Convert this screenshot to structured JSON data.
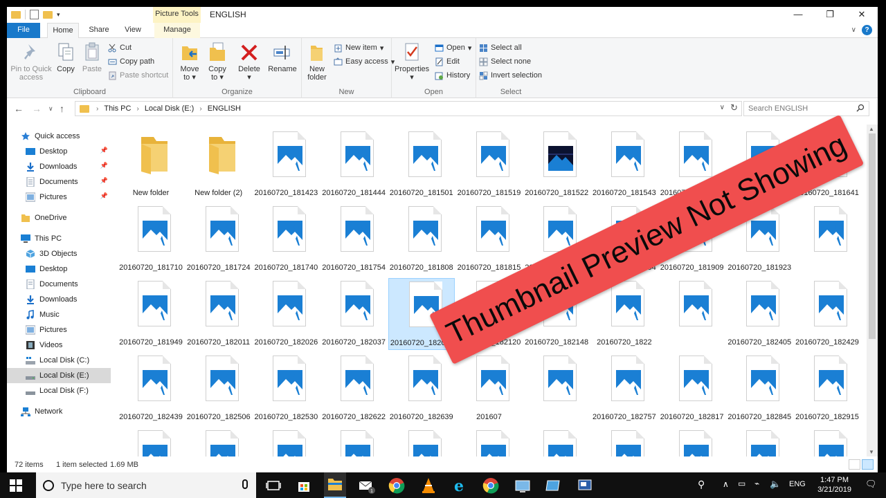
{
  "titlebar": {
    "context_tab": "Picture Tools",
    "title": "ENGLISH",
    "minimize": "—",
    "maximize": "❐",
    "close": "✕"
  },
  "tabs": {
    "file": "File",
    "home": "Home",
    "share": "Share",
    "view": "View",
    "manage": "Manage",
    "help": "?"
  },
  "ribbon": {
    "clipboard": {
      "label": "Clipboard",
      "pin": "Pin to Quick access",
      "copy": "Copy",
      "paste": "Paste",
      "cut": "Cut",
      "copy_path": "Copy path",
      "paste_shortcut": "Paste shortcut"
    },
    "organize": {
      "label": "Organize",
      "move_to": "Move to",
      "copy_to": "Copy to",
      "delete": "Delete",
      "rename": "Rename"
    },
    "new": {
      "label": "New",
      "new_folder": "New folder",
      "new_item": "New item",
      "easy_access": "Easy access"
    },
    "open": {
      "label": "Open",
      "properties": "Properties",
      "open": "Open",
      "edit": "Edit",
      "history": "History"
    },
    "select": {
      "label": "Select",
      "select_all": "Select all",
      "select_none": "Select none",
      "invert": "Invert selection"
    }
  },
  "address": {
    "crumbs": [
      "This PC",
      "Local Disk (E:)",
      "ENGLISH"
    ],
    "search_placeholder": "Search ENGLISH"
  },
  "nav": {
    "quick_access": "Quick access",
    "qa_desktop": "Desktop",
    "qa_downloads": "Downloads",
    "qa_documents": "Documents",
    "qa_pictures": "Pictures",
    "onedrive": "OneDrive",
    "this_pc": "This PC",
    "objects3d": "3D Objects",
    "desktop": "Desktop",
    "documents": "Documents",
    "downloads": "Downloads",
    "music": "Music",
    "pictures": "Pictures",
    "videos": "Videos",
    "disk_c": "Local Disk (C:)",
    "disk_e": "Local Disk (E:)",
    "disk_f": "Local Disk (F:)",
    "network": "Network"
  },
  "files": [
    {
      "name": "New folder",
      "kind": "folder"
    },
    {
      "name": "New folder (2)",
      "kind": "folder"
    },
    {
      "name": "20160720_181423",
      "kind": "image"
    },
    {
      "name": "20160720_181444",
      "kind": "image"
    },
    {
      "name": "20160720_181501",
      "kind": "image"
    },
    {
      "name": "20160720_181519",
      "kind": "image"
    },
    {
      "name": "20160720_181522",
      "kind": "image-dark"
    },
    {
      "name": "20160720_181543",
      "kind": "image"
    },
    {
      "name": "20160720_181559",
      "kind": "image"
    },
    {
      "name": "20160720_181630",
      "kind": "image"
    },
    {
      "name": "20160720_181641",
      "kind": "image"
    },
    {
      "name": "20160720_181710",
      "kind": "image"
    },
    {
      "name": "20160720_181724",
      "kind": "image"
    },
    {
      "name": "20160720_181740",
      "kind": "image"
    },
    {
      "name": "20160720_181754",
      "kind": "image"
    },
    {
      "name": "20160720_181808",
      "kind": "image"
    },
    {
      "name": "20160720_181815",
      "kind": "image"
    },
    {
      "name": "20160720_181840",
      "kind": "image"
    },
    {
      "name": "20160720_181854",
      "kind": "image"
    },
    {
      "name": "20160720_181909",
      "kind": "image"
    },
    {
      "name": "20160720_181923",
      "kind": "image"
    },
    {
      "name": "",
      "kind": "image"
    },
    {
      "name": "20160720_181949",
      "kind": "image"
    },
    {
      "name": "20160720_182011",
      "kind": "image"
    },
    {
      "name": "20160720_182026",
      "kind": "image"
    },
    {
      "name": "20160720_182037",
      "kind": "image"
    },
    {
      "name": "20160720_182058",
      "kind": "image",
      "selected": true
    },
    {
      "name": "20160720_182120",
      "kind": "image"
    },
    {
      "name": "20160720_182148",
      "kind": "image"
    },
    {
      "name": "20160720_1822",
      "kind": "image"
    },
    {
      "name": "",
      "kind": "image"
    },
    {
      "name": "20160720_182405",
      "kind": "image"
    },
    {
      "name": "20160720_182429",
      "kind": "image"
    },
    {
      "name": "20160720_182439",
      "kind": "image"
    },
    {
      "name": "20160720_182506",
      "kind": "image"
    },
    {
      "name": "20160720_182530",
      "kind": "image"
    },
    {
      "name": "20160720_182622",
      "kind": "image"
    },
    {
      "name": "20160720_182639",
      "kind": "image"
    },
    {
      "name": "201607",
      "kind": "image"
    },
    {
      "name": "",
      "kind": "image"
    },
    {
      "name": "20160720_182757",
      "kind": "image"
    },
    {
      "name": "20160720_182817",
      "kind": "image"
    },
    {
      "name": "20160720_182845",
      "kind": "image"
    },
    {
      "name": "20160720_182915",
      "kind": "image"
    },
    {
      "name": "",
      "kind": "image"
    },
    {
      "name": "",
      "kind": "image"
    },
    {
      "name": "",
      "kind": "image"
    },
    {
      "name": "",
      "kind": "image"
    },
    {
      "name": "",
      "kind": "image"
    },
    {
      "name": "",
      "kind": "image"
    },
    {
      "name": "",
      "kind": "image"
    },
    {
      "name": "",
      "kind": "image"
    },
    {
      "name": "",
      "kind": "image"
    },
    {
      "name": "",
      "kind": "image"
    },
    {
      "name": "",
      "kind": "image"
    }
  ],
  "status": {
    "count": "72 items",
    "selected": "1 item selected",
    "size": "1.69 MB"
  },
  "banner": {
    "text": "Thumbnail Preview Not Showing"
  },
  "taskbar": {
    "search_placeholder": "Type here to search",
    "language": "ENG",
    "time": "1:47 PM",
    "date": "3/21/2019"
  },
  "colors": {
    "accent": "#1979ca",
    "image_icon": "#1a7fd4",
    "selection": "#cce8ff",
    "banner": "#f04e4e",
    "folder": "#f0c04e"
  }
}
